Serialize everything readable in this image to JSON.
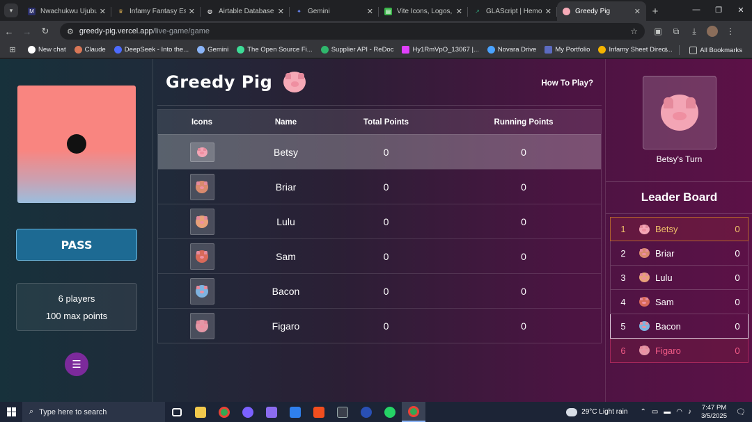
{
  "browser": {
    "tabs": [
      {
        "title": "Nwachukwu Ujubuo",
        "favicon_color": "#2b2f6b",
        "active": false
      },
      {
        "title": "Infamy Fantasy Espo",
        "favicon_color": "#c7a04c",
        "active": false
      },
      {
        "title": "Airtable Database Lin",
        "favicon_color": "#ffffff",
        "active": false
      },
      {
        "title": "Gemini",
        "favicon_color": "#6b8cff",
        "active": false
      },
      {
        "title": "Vite Icons, Logos, Sy",
        "favicon_color": "#3bb54a",
        "active": false
      },
      {
        "title": "GLAScript | Hemoph",
        "favicon_color": "#2fa37a",
        "active": false
      },
      {
        "title": "Greedy Pig",
        "favicon_color": "#f6aab7",
        "active": true
      }
    ],
    "url_host": "greedy-pig.vercel.app",
    "url_path": "/live-game/game",
    "bookmarks": [
      {
        "label": "New chat",
        "color": "#ffffff"
      },
      {
        "label": "Claude",
        "color": "#d97757"
      },
      {
        "label": "DeepSeek - Into the...",
        "color": "#4d6bfe"
      },
      {
        "label": "Gemini",
        "color": "#8ab4f8"
      },
      {
        "label": "The Open Source Fi...",
        "color": "#3ddc97"
      },
      {
        "label": "Supplier API - ReDoc",
        "color": "#2fb66c"
      },
      {
        "label": "Hy1RmVpO_13067 |...",
        "color": "#e040fb"
      },
      {
        "label": "Novara Drive",
        "color": "#4aa3ff"
      },
      {
        "label": "My Portfolio",
        "color": "#5c6bc0"
      },
      {
        "label": "Infamy Sheet Direct...",
        "color": "#f4b400"
      }
    ],
    "all_bookmarks": "All Bookmarks"
  },
  "game": {
    "title": "Greedy Pig",
    "how_to_play": "How To Play?",
    "pass_label": "PASS",
    "players_text": "6 players",
    "max_points_text": "100 max points",
    "table_headers": [
      "Icons",
      "Name",
      "Total Points",
      "Running Points"
    ],
    "players": [
      {
        "name": "Betsy",
        "total": "0",
        "running": "0",
        "color": "#f3a5b5"
      },
      {
        "name": "Briar",
        "total": "0",
        "running": "0",
        "color": "#d98a6e"
      },
      {
        "name": "Lulu",
        "total": "0",
        "running": "0",
        "color": "#e8a17a"
      },
      {
        "name": "Sam",
        "total": "0",
        "running": "0",
        "color": "#d96a5a"
      },
      {
        "name": "Bacon",
        "total": "0",
        "running": "0",
        "color": "#7fb3e0"
      },
      {
        "name": "Figaro",
        "total": "0",
        "running": "0",
        "color": "#e497a6"
      }
    ],
    "turn_text": "Betsy's Turn",
    "leaderboard_title": "Leader Board",
    "leaderboard": [
      {
        "rank": "1",
        "name": "Betsy",
        "points": "0"
      },
      {
        "rank": "2",
        "name": "Briar",
        "points": "0"
      },
      {
        "rank": "3",
        "name": "Lulu",
        "points": "0"
      },
      {
        "rank": "4",
        "name": "Sam",
        "points": "0"
      },
      {
        "rank": "5",
        "name": "Bacon",
        "points": "0"
      },
      {
        "rank": "6",
        "name": "Figaro",
        "points": "0"
      }
    ]
  },
  "taskbar": {
    "search_placeholder": "Type here to search",
    "weather": "29°C  Light rain",
    "time": "7:47 PM",
    "date": "3/5/2025",
    "notification_count": "18",
    "whatsapp_badge": "4"
  }
}
